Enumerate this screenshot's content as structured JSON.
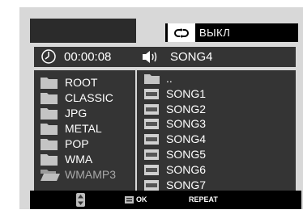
{
  "header": {
    "repeat_icon": "repeat-icon",
    "repeat_state": "ВЫКЛ"
  },
  "status": {
    "time_icon": "clock-icon",
    "elapsed_time": "00:00:08",
    "audio_icon": "speaker-icon",
    "current_track": "SONG4"
  },
  "folders": [
    {
      "label": "ROOT",
      "icon": "folder-icon"
    },
    {
      "label": "CLASSIC",
      "icon": "folder-icon"
    },
    {
      "label": "JPG",
      "icon": "folder-icon"
    },
    {
      "label": "METAL",
      "icon": "folder-icon"
    },
    {
      "label": "POP",
      "icon": "folder-icon"
    },
    {
      "label": "WMA",
      "icon": "folder-icon"
    },
    {
      "label": "WMAMP3",
      "icon": "open-folder-icon",
      "state": "open"
    }
  ],
  "files": [
    {
      "label": "..",
      "icon": "folder-icon"
    },
    {
      "label": "SONG1",
      "icon": "mp3-file-icon"
    },
    {
      "label": "SONG2",
      "icon": "mp3-file-icon"
    },
    {
      "label": "SONG3",
      "icon": "mp3-file-icon"
    },
    {
      "label": "SONG4",
      "icon": "mp3-file-icon"
    },
    {
      "label": "SONG5",
      "icon": "mp3-file-icon"
    },
    {
      "label": "SONG6",
      "icon": "mp3-file-icon"
    },
    {
      "label": "SONG7",
      "icon": "mp3-file-icon"
    }
  ],
  "help_bar": {
    "navigate_icon": "up-down-icon",
    "select_icon": "enter-icon",
    "ok_label": "OK",
    "repeat_label": "REPEAT"
  },
  "colors": {
    "panel": "#343434",
    "background": "#d8d8d8",
    "bar": "#000000",
    "text": "#ffffff"
  }
}
